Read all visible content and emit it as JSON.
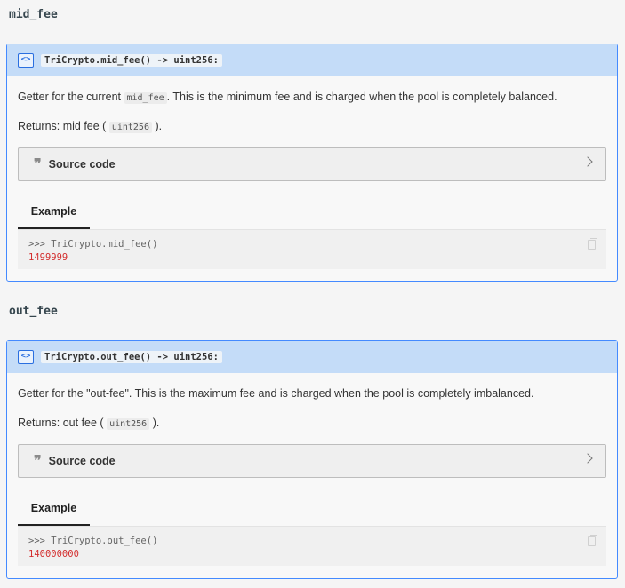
{
  "sections": [
    {
      "heading": "mid_fee",
      "signature": "TriCrypto.mid_fee() -> uint256:",
      "desc_before": "Getter for the current ",
      "desc_code": "mid_fee",
      "desc_after": ". This is the minimum fee and is charged when the pool is completely balanced.",
      "returns_before": "Returns: mid fee ( ",
      "returns_code": "uint256",
      "returns_after": " ).",
      "source_label": "Source code",
      "tab_label": "Example",
      "code_prompt": ">>> TriCrypto.mid_fee()",
      "code_output": "1499999"
    },
    {
      "heading": "out_fee",
      "signature": "TriCrypto.out_fee() -> uint256:",
      "desc_before": "Getter for the \"out-fee\". This is the maximum fee and is charged when the pool is completely imbalanced.",
      "desc_code": "",
      "desc_after": "",
      "returns_before": "Returns: out fee ( ",
      "returns_code": "uint256",
      "returns_after": " ).",
      "source_label": "Source code",
      "tab_label": "Example",
      "code_prompt": ">>> TriCrypto.out_fee()",
      "code_output": "140000000"
    }
  ],
  "icons": {
    "code": "code-brackets-icon",
    "quote": "quote-icon",
    "chevron": "chevron-right-icon",
    "copy": "copy-icon"
  },
  "colors": {
    "accent": "#448aff",
    "title_bg": "#c4dcf8",
    "output": "#d32f2f"
  }
}
